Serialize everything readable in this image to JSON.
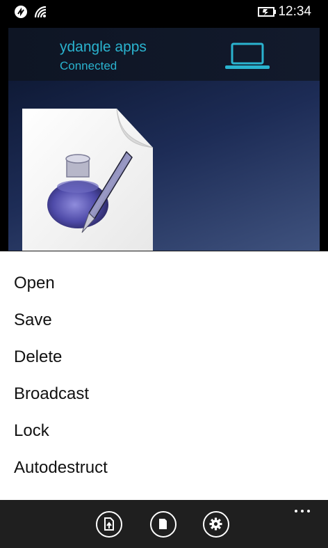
{
  "status_bar": {
    "time": "12:34",
    "icons": [
      "nfc-icon",
      "wifi-icon",
      "battery-charging-icon"
    ]
  },
  "connection": {
    "name": "ydangle apps",
    "status": "Connected",
    "icon": "laptop-icon",
    "accent_color": "#2ab3cf"
  },
  "document": {
    "icon": "text-document-icon"
  },
  "menu": {
    "items": [
      {
        "label": "Open"
      },
      {
        "label": "Save"
      },
      {
        "label": "Delete"
      },
      {
        "label": "Broadcast"
      },
      {
        "label": "Lock"
      },
      {
        "label": "Autodestruct"
      }
    ]
  },
  "app_bar": {
    "buttons": [
      "export-document-icon",
      "page-icon",
      "settings-icon"
    ],
    "more": "more-options-icon"
  }
}
